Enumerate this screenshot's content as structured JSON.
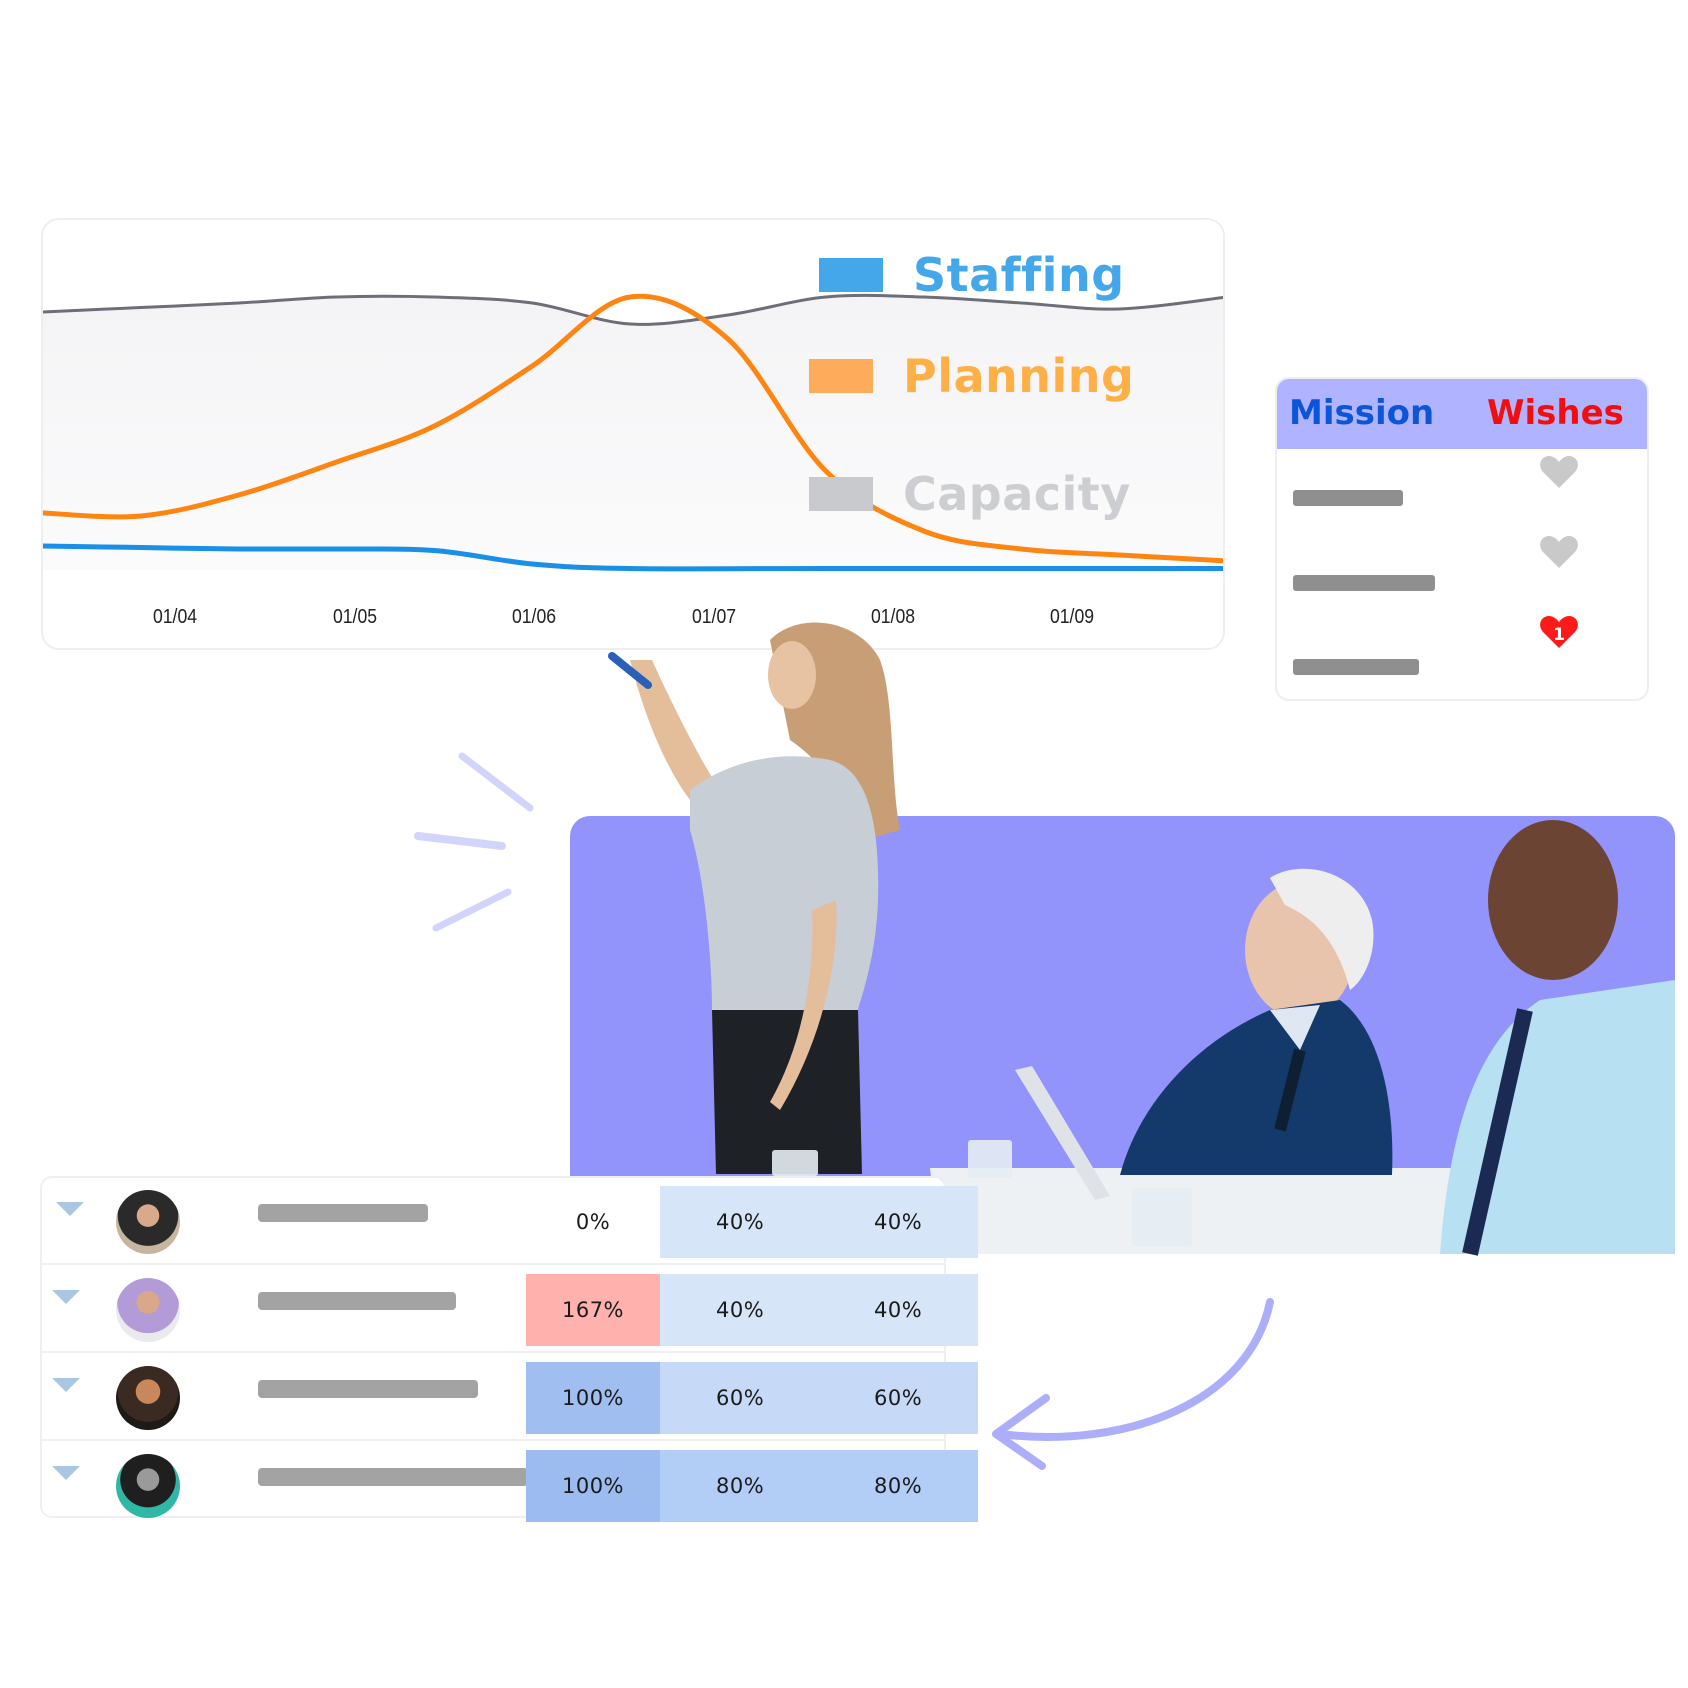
{
  "chart_data": {
    "type": "line",
    "title": "",
    "xlabel": "",
    "ylabel": "",
    "x": [
      "01/04",
      "01/05",
      "01/06",
      "01/07",
      "01/08",
      "01/09"
    ],
    "x_extent": [
      0,
      6.05
    ],
    "ylim": [
      0,
      100
    ],
    "grid": false,
    "legend": "top-right",
    "series": [
      {
        "name": "Staffing",
        "color": "#1a8fe6",
        "points": [
          [
            0,
            8
          ],
          [
            0.5,
            7.5
          ],
          [
            1,
            7
          ],
          [
            1.5,
            7
          ],
          [
            2,
            6.5
          ],
          [
            2.5,
            2
          ],
          [
            3,
            0.5
          ],
          [
            4,
            0.5
          ],
          [
            5,
            0.5
          ],
          [
            6.05,
            0.5
          ]
        ]
      },
      {
        "name": "Planning",
        "color": "#ff8512",
        "points": [
          [
            0,
            19
          ],
          [
            0.5,
            18
          ],
          [
            1,
            25
          ],
          [
            1.5,
            36
          ],
          [
            2,
            48
          ],
          [
            2.5,
            68
          ],
          [
            3,
            91
          ],
          [
            3.5,
            77
          ],
          [
            4,
            33
          ],
          [
            4.5,
            13
          ],
          [
            5,
            7
          ],
          [
            5.5,
            5
          ],
          [
            6.05,
            3
          ]
        ]
      },
      {
        "name": "Capacity",
        "color": "#6e6e78",
        "points": [
          [
            0,
            86
          ],
          [
            0.5,
            87.5
          ],
          [
            1,
            89
          ],
          [
            1.5,
            91
          ],
          [
            2,
            91
          ],
          [
            2.5,
            89
          ],
          [
            3,
            82
          ],
          [
            3.5,
            85
          ],
          [
            4,
            91
          ],
          [
            4.5,
            91
          ],
          [
            5,
            89
          ],
          [
            5.5,
            87
          ],
          [
            6.05,
            91
          ]
        ]
      }
    ]
  },
  "legend": {
    "items": [
      {
        "label": "Staffing",
        "swatch": "#43a7ea",
        "color": "#43a7ea"
      },
      {
        "label": "Planning",
        "swatch": "#feac5c",
        "color": "#feb046"
      },
      {
        "label": "Capacity",
        "swatch": "#c9cacd",
        "color": "#cdced1"
      }
    ]
  },
  "mission_card": {
    "mission_label": "Mission",
    "wishes_label": "Wishes",
    "header_color": "#b0b3ff",
    "rows": [
      {
        "liked": false,
        "count": ""
      },
      {
        "liked": false,
        "count": ""
      },
      {
        "liked": true,
        "count": "1"
      }
    ]
  },
  "photo_panel": {
    "background": "#9293fb"
  },
  "table": {
    "rows": [
      {
        "cells": [
          "0%",
          "40%",
          "40%"
        ],
        "c1_bg": "#ffffff",
        "c2_bg": "#d6e5f8"
      },
      {
        "cells": [
          "167%",
          "40%",
          "40%"
        ],
        "c1_bg": "#ffb1ae",
        "c2_bg": "#d6e5f8"
      },
      {
        "cells": [
          "100%",
          "60%",
          "60%"
        ],
        "c1_bg": "#a0bff0",
        "c2_bg": "#c6daf7"
      },
      {
        "cells": [
          "100%",
          "80%",
          "80%"
        ],
        "c1_bg": "#9cbcf0",
        "c2_bg": "#b2cdf6"
      }
    ]
  }
}
